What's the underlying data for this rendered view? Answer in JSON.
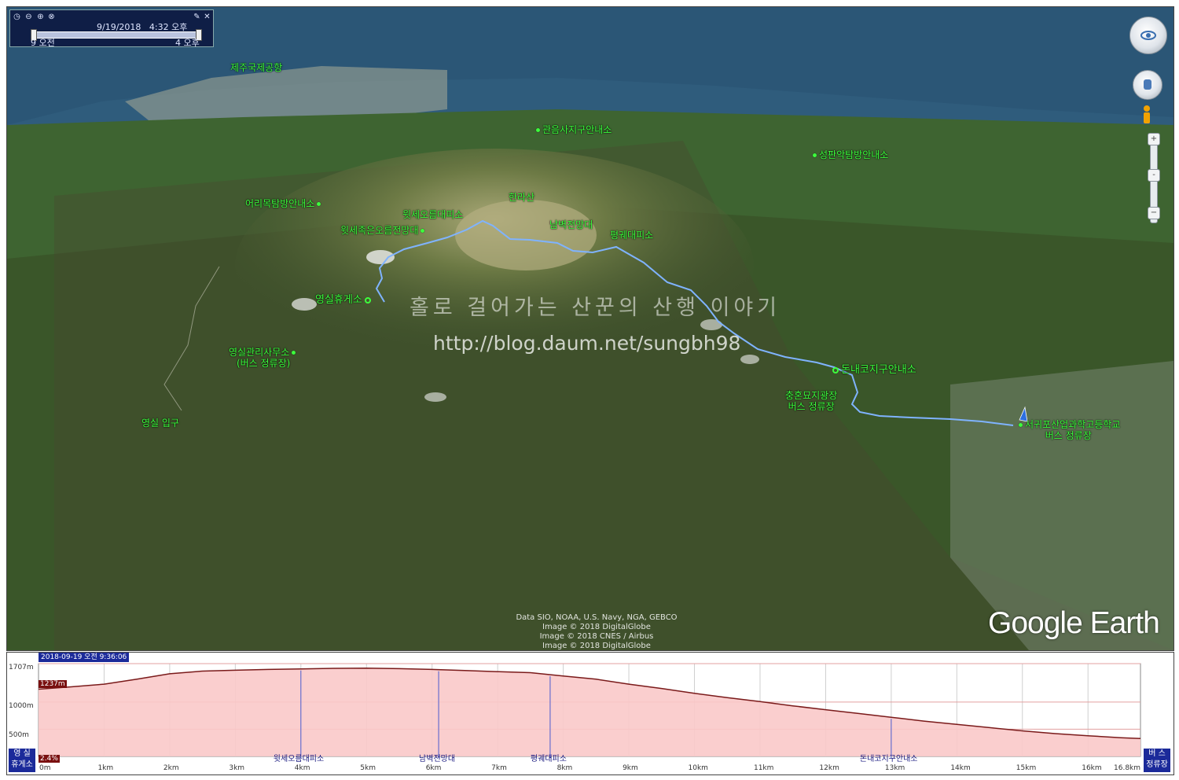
{
  "timebar": {
    "date": "9/19/2018",
    "time": "4:32 오후",
    "start_label": "9 오전",
    "end_label": "4 오후",
    "icons": [
      "clock-icon",
      "zoom-out-icon",
      "zoom-in-icon",
      "settings-icon",
      "wrench-icon",
      "close-icon"
    ]
  },
  "places": {
    "jeju_airport": "제주국제공항",
    "gwaneumsa": "관음사지구안내소",
    "seongpanak": "성판악탐방안내소",
    "eorimok": "어리목탐방안내소",
    "hallasan": "한라산",
    "witse_shelter": "윗세오름대피소",
    "witse_small": "윗세족은오름전망대",
    "nambyeok": "남벽전망대",
    "pyeonggwe": "평궤대피소",
    "yeongsil_rest": "영실휴게소",
    "yeongsil_office_1": "영실관리사무소",
    "yeongsil_office_2": "(버스 정류장)",
    "yeongsil_entrance": "영실 입구",
    "donnaeko": "돈내코지구안내소",
    "chunghon_1": "충혼묘지광장",
    "chunghon_2": "버스 정류장",
    "seogwipo_1": "서귀포산업과학고등학교",
    "seogwipo_2": "버스 정류장"
  },
  "watermark": {
    "title": "홀로 걸어가는 산꾼의 산행 이야기",
    "url": "http://blog.daum.net/sungbh98"
  },
  "credits": [
    "Data SIO, NOAA, U.S. Navy, NGA, GEBCO",
    "Image © 2018 DigitalGlobe",
    "Image © 2018 CNES / Airbus",
    "Image © 2018 DigitalGlobe"
  ],
  "logo": "Google Earth",
  "colors": {
    "route": "#7fb3ff",
    "label": "#3dff3d",
    "profile_fill": "#f9c9c9",
    "profile_line": "#7a1a1a",
    "accent": "#1b2a9a"
  },
  "elevation": {
    "timestamp": "2018-09-19 오전 9:36:06",
    "y_labels": [
      "1707m",
      "1000m",
      "500m"
    ],
    "start_value": "1237m",
    "grade": "2.4%",
    "x_labels": [
      "0m",
      "1km",
      "2km",
      "3km",
      "4km",
      "5km",
      "6km",
      "7km",
      "8km",
      "9km",
      "10km",
      "11km",
      "12km",
      "13km",
      "14km",
      "15km",
      "16km",
      "16.8km"
    ],
    "left_box": [
      "영 실",
      "휴게소"
    ],
    "right_box": [
      "버 스",
      "정류장"
    ],
    "waypoints": [
      {
        "name": "윗세오름대피소",
        "km": 4.0
      },
      {
        "name": "남벽전망대",
        "km": 6.1
      },
      {
        "name": "평궤대피소",
        "km": 7.8
      },
      {
        "name": "돈내코지구안내소",
        "km": 13.0
      }
    ],
    "profile": [
      [
        0,
        1237
      ],
      [
        0.5,
        1280
      ],
      [
        1,
        1330
      ],
      [
        1.5,
        1420
      ],
      [
        2,
        1520
      ],
      [
        2.5,
        1570
      ],
      [
        3,
        1585
      ],
      [
        3.5,
        1600
      ],
      [
        4,
        1610
      ],
      [
        4.5,
        1620
      ],
      [
        5,
        1625
      ],
      [
        5.5,
        1615
      ],
      [
        6,
        1600
      ],
      [
        6.5,
        1580
      ],
      [
        7,
        1560
      ],
      [
        7.5,
        1540
      ],
      [
        8,
        1480
      ],
      [
        8.5,
        1420
      ],
      [
        9,
        1330
      ],
      [
        9.5,
        1250
      ],
      [
        10,
        1160
      ],
      [
        10.5,
        1080
      ],
      [
        11,
        1010
      ],
      [
        11.5,
        930
      ],
      [
        12,
        860
      ],
      [
        12.5,
        790
      ],
      [
        13,
        720
      ],
      [
        13.5,
        650
      ],
      [
        14,
        590
      ],
      [
        14.5,
        530
      ],
      [
        15,
        470
      ],
      [
        15.5,
        420
      ],
      [
        16,
        380
      ],
      [
        16.5,
        345
      ],
      [
        16.8,
        330
      ]
    ],
    "y_max_m": 1707,
    "x_max_km": 16.8
  }
}
